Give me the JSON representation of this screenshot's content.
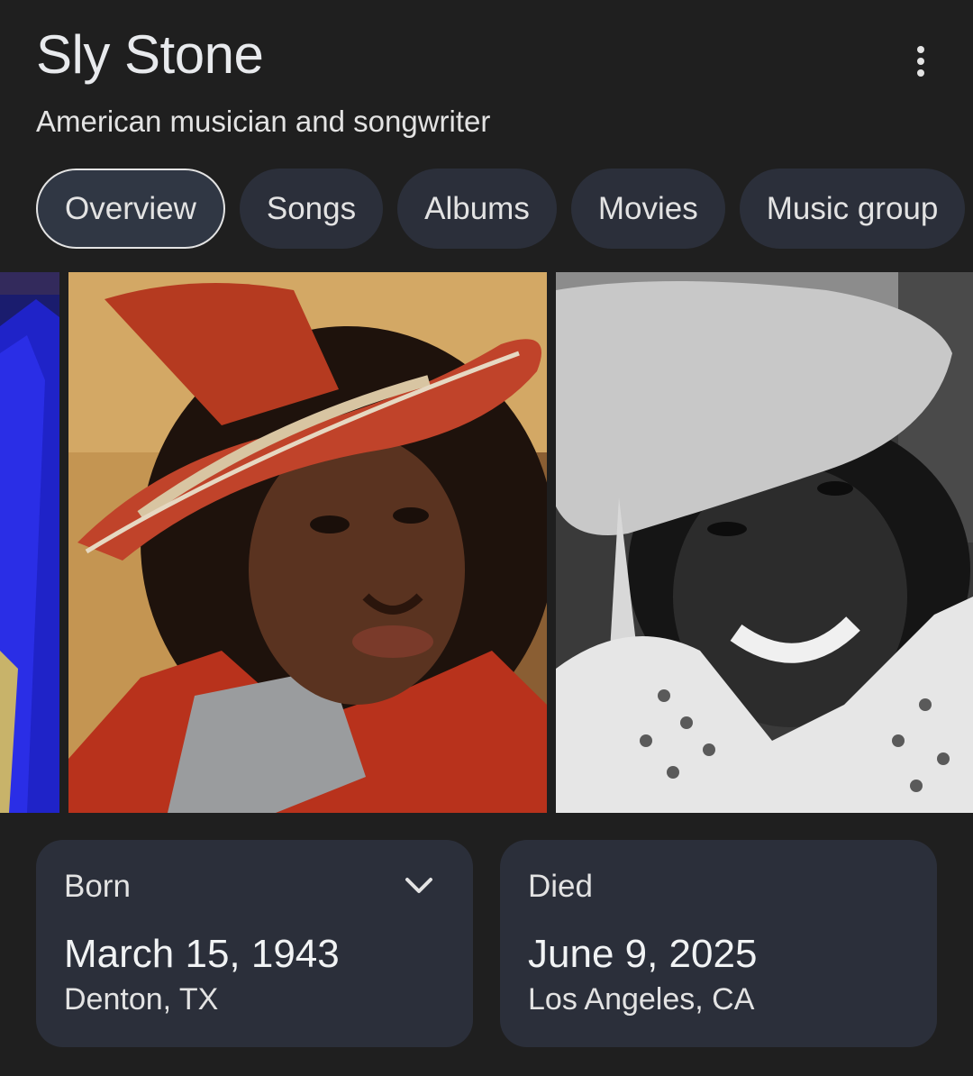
{
  "header": {
    "title": "Sly Stone",
    "subtitle": "American musician and songwriter",
    "more_icon": "more-vert-icon"
  },
  "tabs": [
    {
      "label": "Overview",
      "active": true
    },
    {
      "label": "Songs",
      "active": false
    },
    {
      "label": "Albums",
      "active": false
    },
    {
      "label": "Movies",
      "active": false
    },
    {
      "label": "Music group",
      "active": false
    }
  ],
  "cards": {
    "born": {
      "label": "Born",
      "date": "March 15, 1943",
      "place": "Denton, TX",
      "icon": "chevron-down-icon"
    },
    "died": {
      "label": "Died",
      "date": "June 9, 2025",
      "place": "Los Angeles, CA"
    }
  },
  "colors": {
    "background": "#1f1f1f",
    "chip": "#2b2f3a",
    "card": "#2b2f3a",
    "text": "#e3e3e3"
  }
}
